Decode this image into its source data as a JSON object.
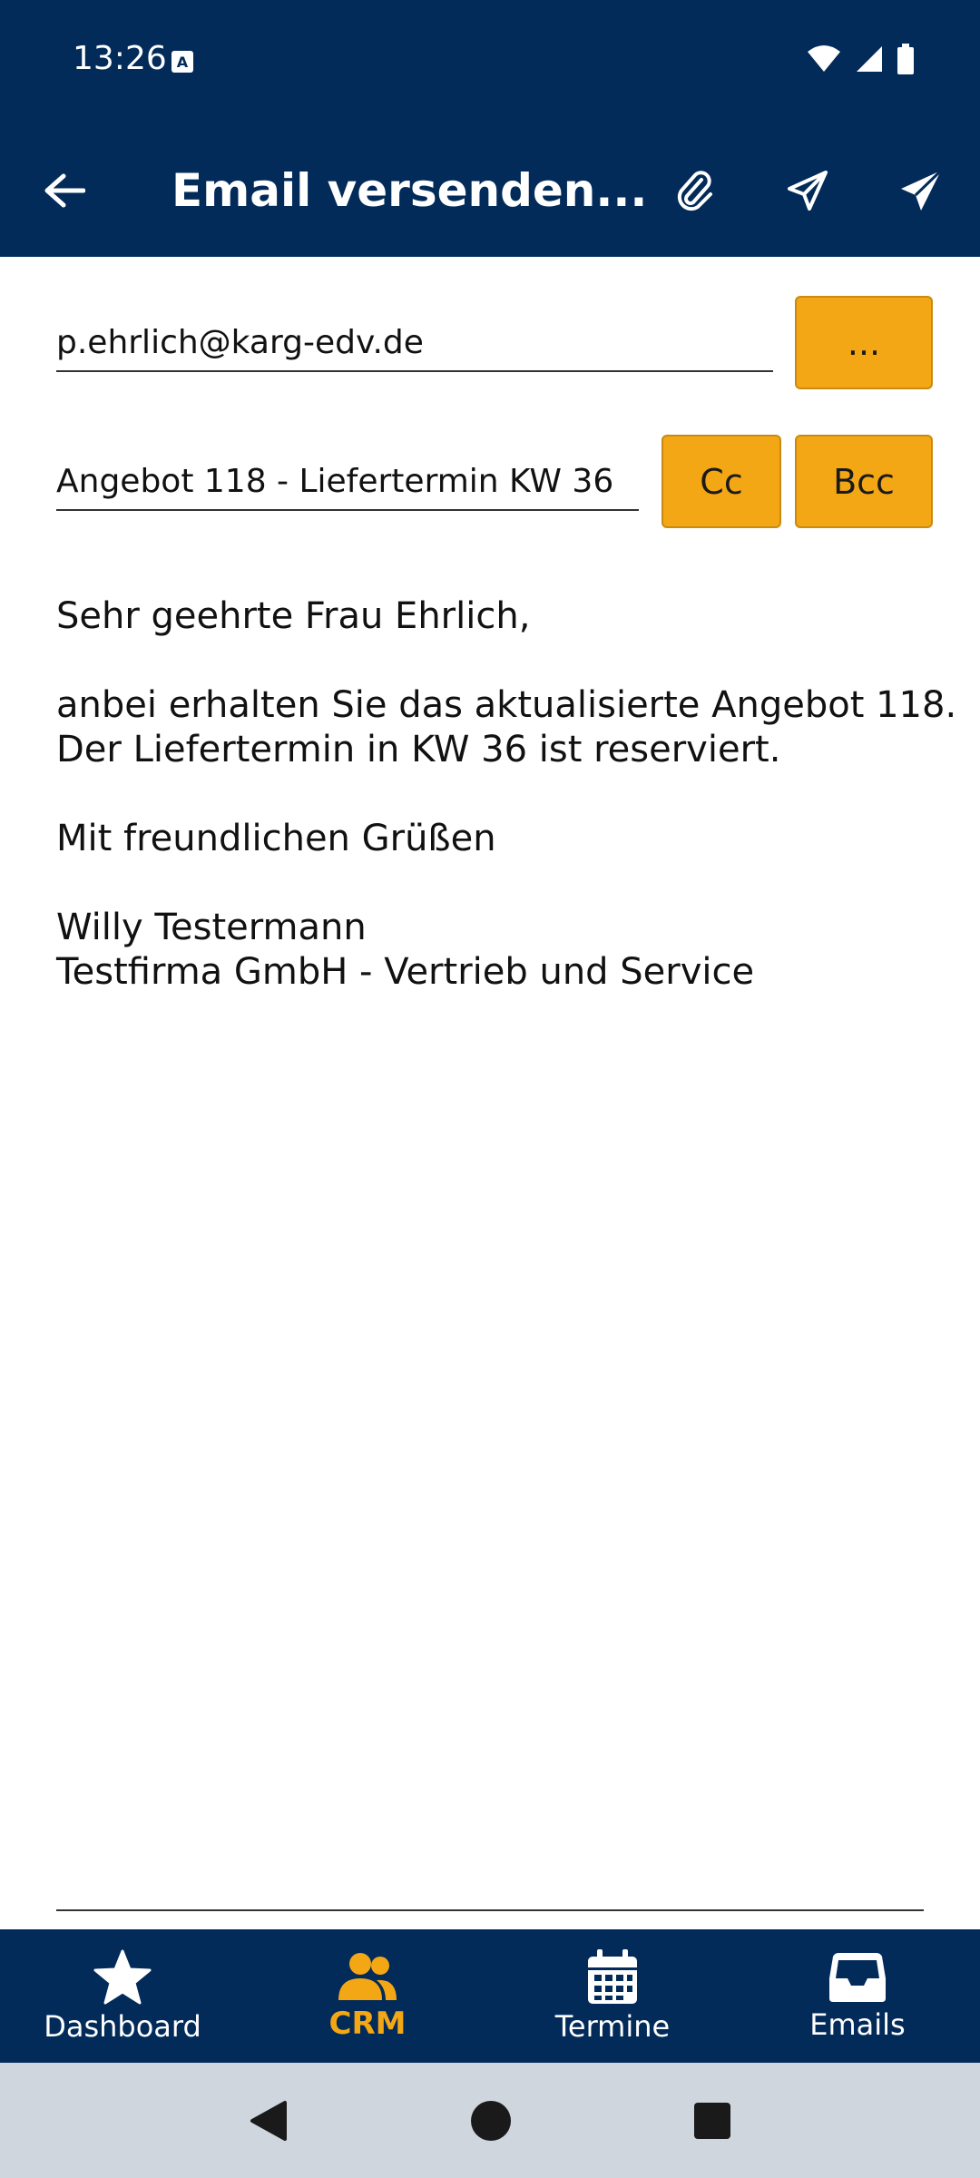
{
  "status_bar": {
    "time": "13:26"
  },
  "app_bar": {
    "title": "Email versenden..."
  },
  "form": {
    "to_value": "p.ehrlich@karg-edv.de",
    "more_label": "...",
    "subject_value": "Angebot 118 - Liefertermin KW 36",
    "cc_label": "Cc",
    "bcc_label": "Bcc"
  },
  "message": {
    "greeting": "Sehr geehrte Frau Ehrlich,",
    "line1": "anbei erhalten Sie das aktualisierte Angebot 118.",
    "line2": "Der Liefertermin in KW 36 ist reserviert.",
    "closing": "Mit freundlichen Grüßen",
    "sender_name": "Willy Testermann",
    "sender_company": "Testfirma GmbH - Vertrieb und Service"
  },
  "bottom_nav": {
    "items": [
      {
        "label": "Dashboard",
        "icon": "star-icon"
      },
      {
        "label": "CRM",
        "icon": "people-icon",
        "active": true
      },
      {
        "label": "Termine",
        "icon": "calendar-icon"
      },
      {
        "label": "Emails",
        "icon": "inbox-icon"
      }
    ]
  },
  "colors": {
    "primary": "#022b5a",
    "accent": "#f4a714",
    "system_nav": "#cfd6de"
  }
}
